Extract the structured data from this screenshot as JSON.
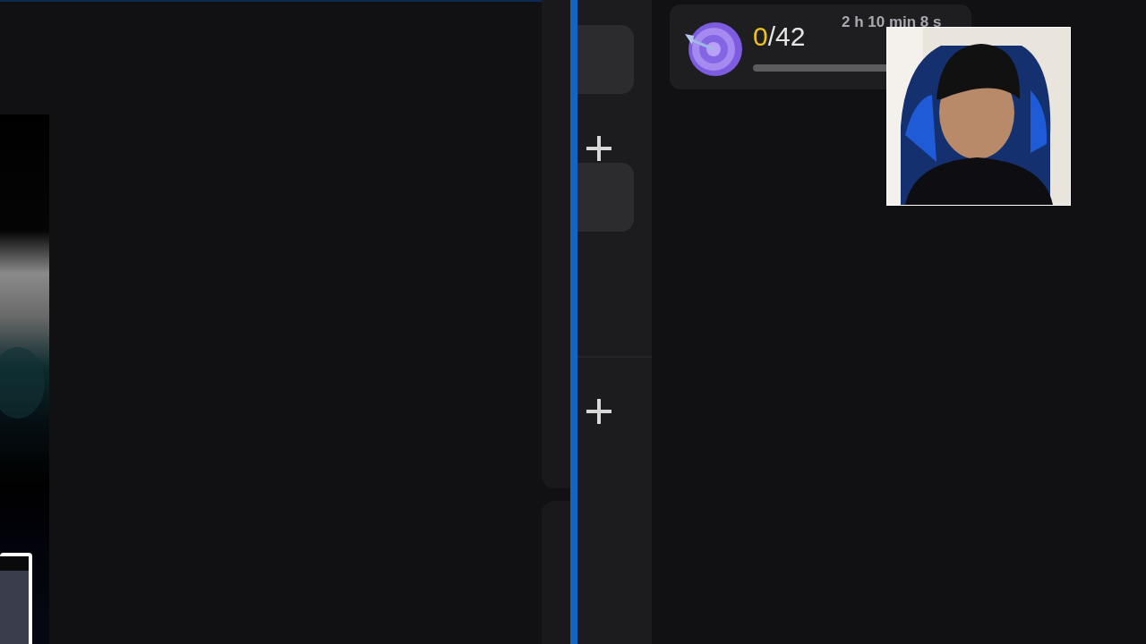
{
  "goal": {
    "done": "0",
    "total": "/42",
    "time": "2 h 10 min 8 s",
    "level": 0
  }
}
